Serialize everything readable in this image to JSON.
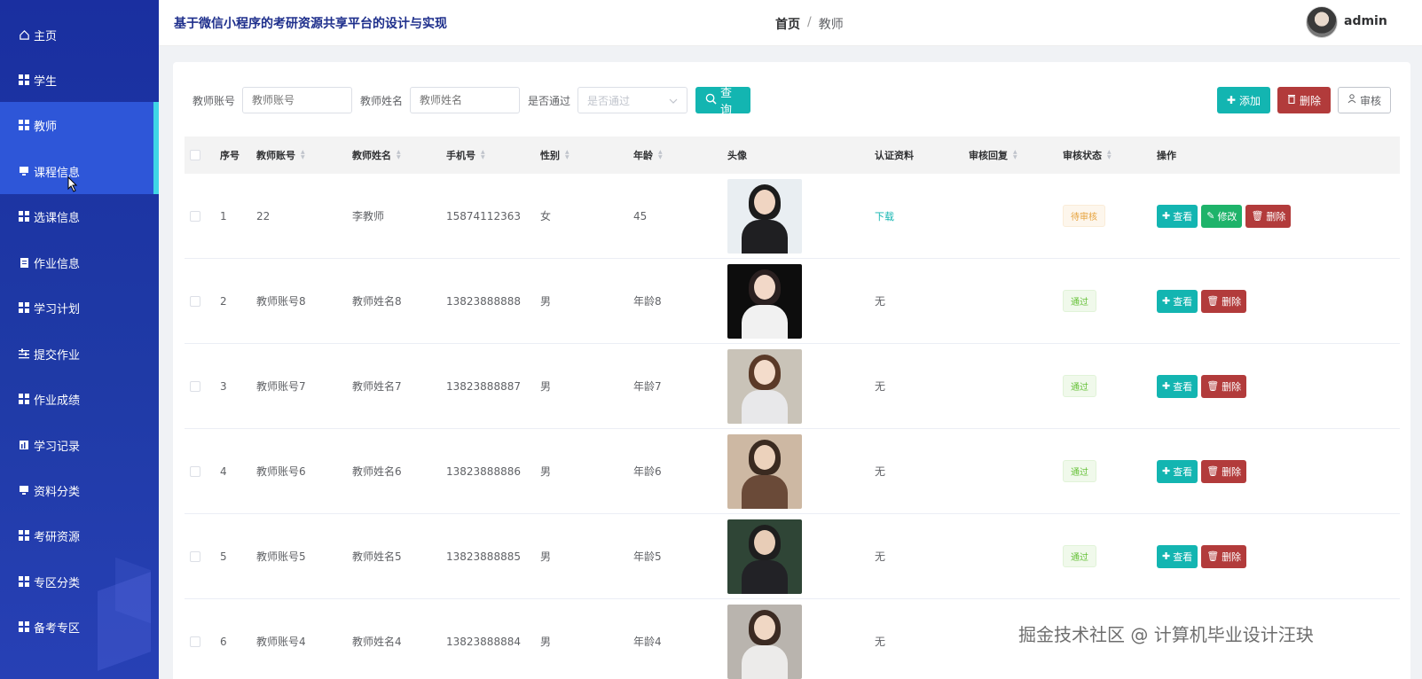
{
  "sidebar": {
    "items": [
      {
        "label": "主页",
        "icon": "home-icon"
      },
      {
        "label": "学生",
        "icon": "grid-icon"
      },
      {
        "label": "教师",
        "icon": "grid-icon"
      },
      {
        "label": "课程信息",
        "icon": "monitor-icon",
        "active": true
      },
      {
        "label": "选课信息",
        "icon": "grid-icon"
      },
      {
        "label": "作业信息",
        "icon": "clipboard-icon"
      },
      {
        "label": "学习计划",
        "icon": "grid-icon"
      },
      {
        "label": "提交作业",
        "icon": "sliders-icon"
      },
      {
        "label": "作业成绩",
        "icon": "grid-icon"
      },
      {
        "label": "学习记录",
        "icon": "chart-icon"
      },
      {
        "label": "资料分类",
        "icon": "monitor-icon"
      },
      {
        "label": "考研资源",
        "icon": "grid-icon"
      },
      {
        "label": "专区分类",
        "icon": "grid-icon"
      },
      {
        "label": "备考专区",
        "icon": "grid-icon"
      }
    ]
  },
  "header": {
    "title": "基于微信小程序的考研资源共享平台的设计与实现",
    "breadcrumb_home": "首页",
    "breadcrumb_sep": "/",
    "breadcrumb_current": "教师",
    "username": "admin"
  },
  "search": {
    "account_label": "教师账号",
    "account_placeholder": "教师账号",
    "name_label": "教师姓名",
    "name_placeholder": "教师姓名",
    "pass_label": "是否通过",
    "pass_placeholder": "是否通过",
    "query_label": "查询"
  },
  "toolbar": {
    "add_label": "添加",
    "delete_label": "删除",
    "review_label": "审核"
  },
  "table": {
    "columns": [
      "序号",
      "教师账号",
      "教师姓名",
      "手机号",
      "性别",
      "年龄",
      "头像",
      "认证资料",
      "审核回复",
      "审核状态",
      "操作"
    ],
    "rows": [
      {
        "no": "1",
        "account": "22",
        "name": "李教师",
        "phone": "15874112363",
        "gender": "女",
        "age": "45",
        "cert": "下载",
        "reply": "",
        "status": "待审核",
        "status_type": "pending",
        "ops": [
          "查看",
          "修改",
          "删除"
        ]
      },
      {
        "no": "2",
        "account": "教师账号8",
        "name": "教师姓名8",
        "phone": "13823888888",
        "gender": "男",
        "age": "年龄8",
        "cert": "无",
        "reply": "",
        "status": "通过",
        "status_type": "pass",
        "ops": [
          "查看",
          "删除"
        ]
      },
      {
        "no": "3",
        "account": "教师账号7",
        "name": "教师姓名7",
        "phone": "13823888887",
        "gender": "男",
        "age": "年龄7",
        "cert": "无",
        "reply": "",
        "status": "通过",
        "status_type": "pass",
        "ops": [
          "查看",
          "删除"
        ]
      },
      {
        "no": "4",
        "account": "教师账号6",
        "name": "教师姓名6",
        "phone": "13823888886",
        "gender": "男",
        "age": "年龄6",
        "cert": "无",
        "reply": "",
        "status": "通过",
        "status_type": "pass",
        "ops": [
          "查看",
          "删除"
        ]
      },
      {
        "no": "5",
        "account": "教师账号5",
        "name": "教师姓名5",
        "phone": "13823888885",
        "gender": "男",
        "age": "年龄5",
        "cert": "无",
        "reply": "",
        "status": "通过",
        "status_type": "pass",
        "ops": [
          "查看",
          "删除"
        ]
      },
      {
        "no": "6",
        "account": "教师账号4",
        "name": "教师姓名4",
        "phone": "13823888884",
        "gender": "男",
        "age": "年龄4",
        "cert": "无",
        "reply": "",
        "status": "",
        "status_type": "pass",
        "ops": []
      }
    ]
  },
  "watermark": "掘金技术社区 @ 计算机毕业设计汪玦",
  "colors": {
    "sidebar": "#1f3aa6",
    "accent": "#13b5b1",
    "danger": "#b23b3b",
    "success": "#1eb36a"
  }
}
